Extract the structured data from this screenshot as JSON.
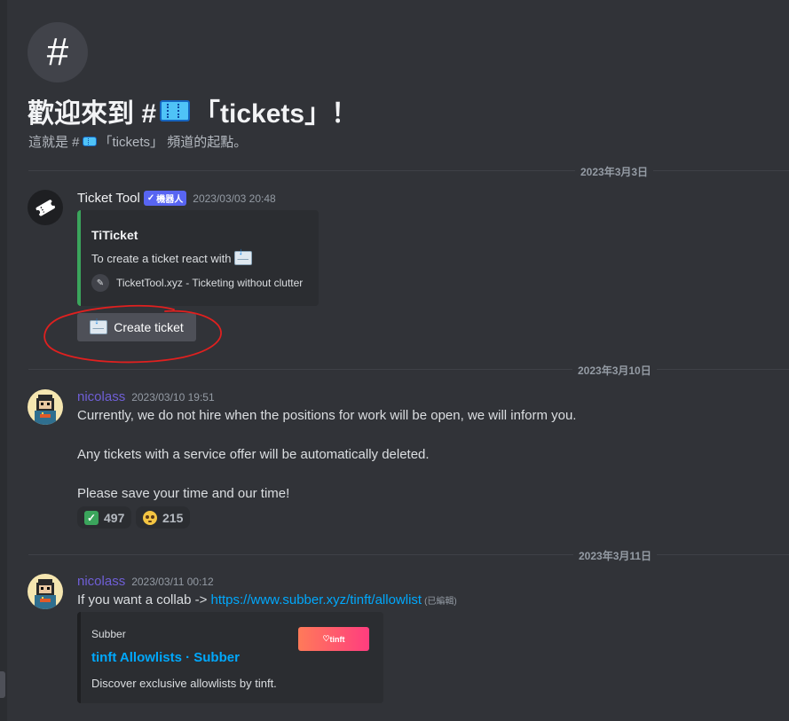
{
  "welcome": {
    "hash_icon": "#",
    "title_prefix": "歡迎來到 #",
    "title_channel": "「tickets」！",
    "subtitle_prefix": "這就是 #",
    "subtitle_suffix": "「tickets」 頻道的起點。"
  },
  "dividers": [
    {
      "date": "2023年3月3日"
    },
    {
      "date": "2023年3月10日"
    },
    {
      "date": "2023年3月11日"
    }
  ],
  "messages": [
    {
      "author": "Ticket Tool",
      "bot_tag": "機器人",
      "timestamp": "2023/03/03 20:48",
      "embed": {
        "title": "TiTicket",
        "description": "To create a ticket react with",
        "footer": "TicketTool.xyz - Ticketing without clutter"
      },
      "button_label": "Create ticket"
    },
    {
      "author": "nicolass",
      "timestamp": "2023/03/10 19:51",
      "lines": [
        "Currently, we do not hire when the positions for work will be open, we will inform you.",
        "Any tickets with a service offer will be automatically deleted.",
        "Please save your time and our time!"
      ],
      "reactions": [
        {
          "emoji": "check-mark",
          "count": "497"
        },
        {
          "emoji": "pleading-face",
          "count": "215"
        }
      ]
    },
    {
      "author": "nicolass",
      "timestamp": "2023/03/11 00:12",
      "text_prefix": "If you want a collab -> ",
      "link": "https://www.subber.xyz/tinft/allowlist",
      "edited": "(已編輯)",
      "embed": {
        "provider": "Subber",
        "title": "tinft Allowlists · Subber",
        "description": "Discover exclusive allowlists by tinft.",
        "thumbnail_text": "tinft"
      }
    }
  ],
  "colors": {
    "background": "#313338",
    "embed_bg": "#2b2d31",
    "link": "#00a8fc",
    "bot_tag": "#5865f2",
    "embed_accent": "#3ba55c",
    "annotation_circle": "#e0201f"
  }
}
